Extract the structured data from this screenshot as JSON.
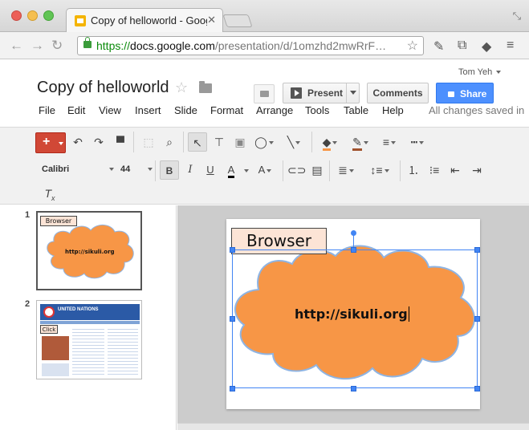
{
  "browser": {
    "tab_title": "Copy of helloworld - Goog",
    "url_protocol": "https://",
    "url_host": "docs.google.com",
    "url_path": "/presentation/d/1omzhd2mwRrF…"
  },
  "header": {
    "doc_title": "Copy of helloworld",
    "user": "Tom Yeh",
    "present_label": "Present",
    "comments_label": "Comments",
    "share_label": "Share",
    "saved_status": "All changes saved in"
  },
  "menu": {
    "items": [
      "File",
      "Edit",
      "View",
      "Insert",
      "Slide",
      "Format",
      "Arrange",
      "Tools",
      "Table",
      "Help"
    ]
  },
  "format_toolbar": {
    "font": "Calibri",
    "size": "44",
    "bold": "B",
    "italic": "I",
    "underline": "U",
    "text_color": "A",
    "highlight": "A"
  },
  "filmstrip": {
    "slides": [
      {
        "number": "1",
        "label": "Browser",
        "cloud_text": "http://sikuli.org"
      },
      {
        "number": "2",
        "banner": "UNITED NATIONS",
        "click_label": "Click"
      }
    ]
  },
  "slide": {
    "label": "Browser",
    "cloud_text": "http://sikuli.org"
  },
  "colors": {
    "cloud_fill": "#f79646",
    "cloud_stroke": "#8eb4e3",
    "label_fill": "#fce4d6",
    "share_blue": "#4d90fe",
    "new_red": "#d14836",
    "selection": "#4285f4"
  }
}
